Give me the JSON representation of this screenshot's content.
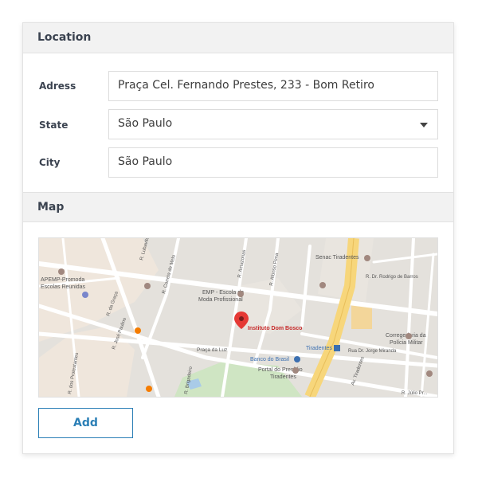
{
  "location": {
    "title": "Location",
    "address": {
      "label": "Adress",
      "value": "Praça Cel. Fernando Prestes, 233 - Bom Retiro"
    },
    "state": {
      "label": "State",
      "value": "São Paulo"
    },
    "city": {
      "label": "City",
      "value": "São Paulo"
    }
  },
  "map": {
    "title": "Map",
    "labels": {
      "apemp": "APEMP-Promoda",
      "escolas": "Escolas Reunidas",
      "emp": "EMP - Escola de",
      "moda": "Moda Profissional",
      "instituto": "Instituto Dom Bosco",
      "banco": "Banco do Brasil",
      "portal1": "Portal do Presídio",
      "portal2": "Tiradentes",
      "senac": "Senac Tiradentes",
      "tiradentes": "Tiradentes",
      "av_tiradentes": "Av. Tiradentes",
      "corregedoria1": "Corregedoria da",
      "corregedoria2": "Polícia Militar",
      "praca_luz": "Praça da Luz",
      "rodrigo": "R. Dr. Rodrigo de Barros",
      "jorge": "Rua Dr. Jorge Miranda",
      "graca": "R. da Graça",
      "jose": "R. José Paulino",
      "correia": "R. Correia de Melo",
      "amazonas": "R. Amazonas",
      "afonso": "R. Afonso Pena",
      "julio": "R. Júlio Pr...",
      "brigadeiro": "R. Brigadeiro",
      "protestantes": "R. dos Protestantes",
      "lubavitch": "R. Lubavitch"
    }
  },
  "actions": {
    "add_label": "Add"
  },
  "colors": {
    "accent": "#2b7fb6",
    "pin": "#e53935"
  }
}
